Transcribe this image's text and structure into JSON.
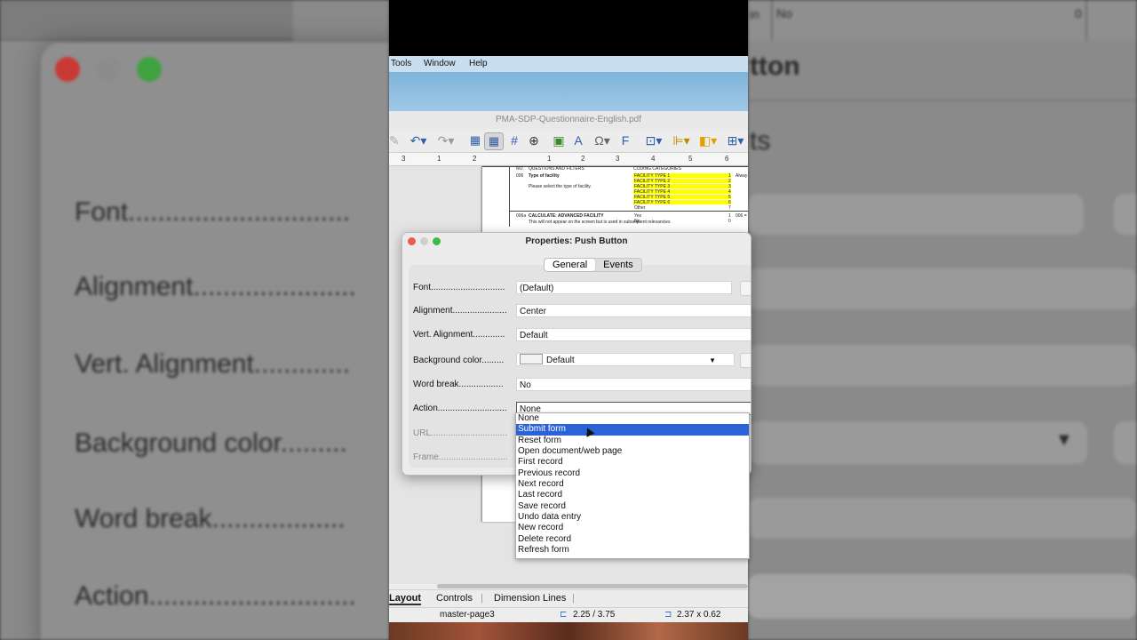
{
  "menubar": {
    "items": [
      "Tools",
      "Window",
      "Help"
    ]
  },
  "window": {
    "title": "PMA-SDP-Questionnaire-English.pdf"
  },
  "ruler": {
    "marks": [
      "3",
      "1",
      "2",
      "1",
      "2",
      "3",
      "4",
      "5",
      "6"
    ]
  },
  "document": {
    "header": [
      "NO.",
      "QUESTIONS AND FILTERS",
      "CODING CATEGORIES"
    ],
    "q1_no": "006",
    "q1_title": "Type of facility",
    "q1_note": "Please select the type of facility.",
    "facility_types": [
      "FACILITY TYPE 1",
      "FACILITY TYPE 2",
      "FACILITY TYPE 3",
      "FACILITY TYPE 4",
      "FACILITY TYPE 5",
      "FACILITY TYPE 6"
    ],
    "facility_codes": [
      "1",
      "2",
      "3",
      "4",
      "5",
      "6"
    ],
    "other": "Other",
    "other_code": "7",
    "side_note": "Alway",
    "q2_no": "006a",
    "q2_title": "CALCULATE: ADVANCED FACILITY",
    "q2_note": "This will not appear on the screen but is used in subsequent relevancies",
    "yes": "Yes",
    "yes_code": "1",
    "no": "No",
    "no_code": "0",
    "q2_side": "006 ="
  },
  "dialog": {
    "title": "Properties: Push Button",
    "tabs": [
      "General",
      "Events"
    ],
    "labels": {
      "font": "Font..............................",
      "alignment": "Alignment......................",
      "vert_alignment": "Vert. Alignment.............",
      "background_color": "Background color.........",
      "word_break": "Word break..................",
      "action": "Action............................",
      "url": "URL...............................",
      "frame": "Frame............................"
    },
    "values": {
      "font": "(Default)",
      "alignment": "Center",
      "vert_alignment": "Default",
      "background_color": "Default",
      "word_break": "No",
      "action": "None"
    }
  },
  "action_options": [
    "None",
    "Submit form",
    "Reset form",
    "Open document/web page",
    "First record",
    "Previous record",
    "Next record",
    "Last record",
    "Save record",
    "Undo data entry",
    "New record",
    "Delete record",
    "Refresh form"
  ],
  "action_highlighted": "Submit form",
  "bottom_tabs": [
    "Layout",
    "Controls",
    "Dimension Lines"
  ],
  "status": {
    "page": "master-page3",
    "position": "2.25 / 3.75",
    "size": "2.37 x 0.62"
  },
  "background": {
    "left_labels": [
      "Font..............................",
      "Alignment......................",
      "Vert. Alignment.............",
      "Background color.........",
      "Word break..................",
      "Action............................"
    ],
    "right_title_fragment": "tton",
    "right_tab_fragment": "ts",
    "right_top_text": [
      "in",
      "No",
      "0"
    ]
  }
}
